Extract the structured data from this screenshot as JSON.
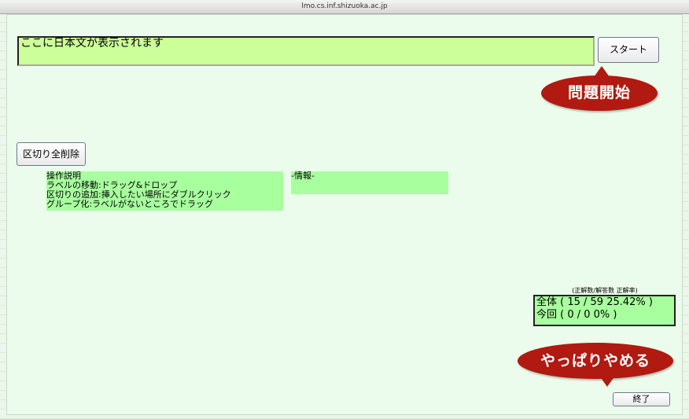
{
  "window": {
    "url": "lmo.cs.inf.shizuoka.ac.jp"
  },
  "display": {
    "text": "ここに日本文が表示されます"
  },
  "buttons": {
    "start": "スタート",
    "clear_all": "区切り全削除",
    "end": "終了"
  },
  "callouts": {
    "start": "問題開始",
    "quit": "やっぱりやめる"
  },
  "instructions": {
    "lines": [
      "操作説明",
      "ラベルの移動:ドラッグ&ドロップ",
      "区切りの追加:挿入したい場所にダブルクリック",
      "グループ化:ラベルがないところでドラッグ"
    ]
  },
  "info": {
    "title": "-情報-"
  },
  "score": {
    "caption": "(正解数/解答数 正解率)",
    "total": "全体 ( 15 / 59 25.42% )",
    "current": "今回 ( 0 / 0 0% )"
  },
  "colors": {
    "display_bg": "#ccff99",
    "panel_bg": "#a8ff9e",
    "callout_bg": "#b01a10",
    "page_bg": "#ecfcec"
  }
}
